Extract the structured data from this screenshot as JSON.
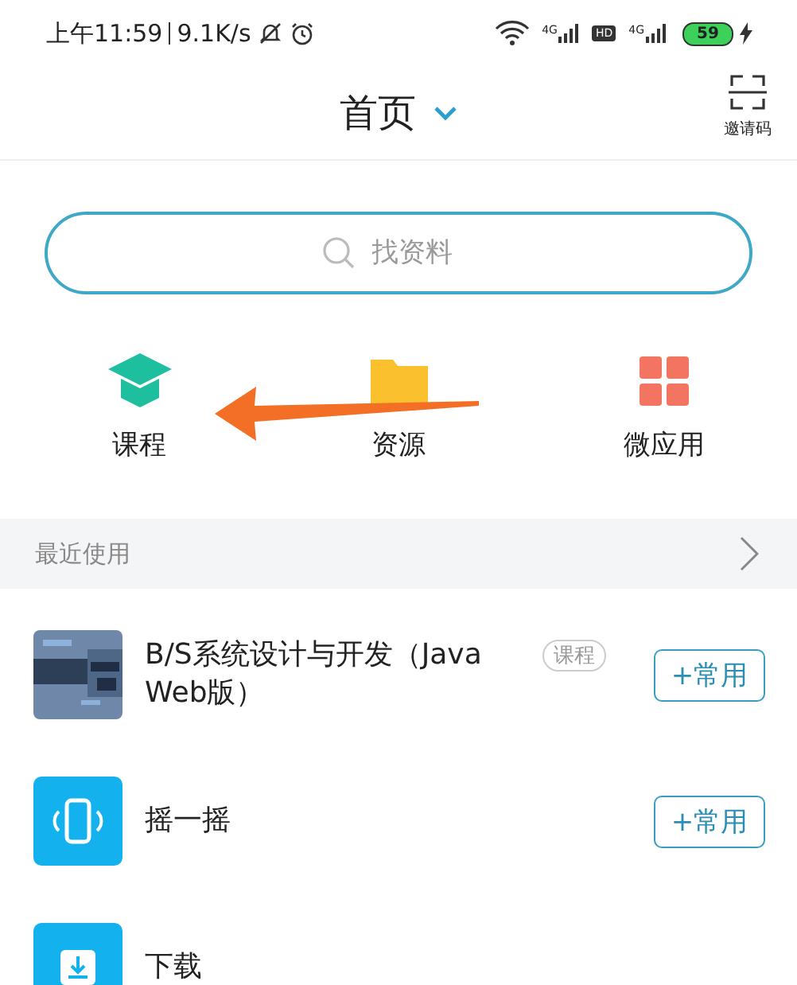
{
  "status_bar": {
    "time": "上午11:59",
    "speed": "9.1K/s",
    "networks": [
      {
        "label": "4G"
      },
      {
        "label": "4G"
      }
    ],
    "hd": "HD",
    "battery": "59"
  },
  "header": {
    "title": "首页",
    "invite_label": "邀请码"
  },
  "search": {
    "placeholder": "找资料"
  },
  "shortcuts": [
    {
      "kind": "course",
      "label": "课程"
    },
    {
      "kind": "resource",
      "label": "资源"
    },
    {
      "kind": "app",
      "label": "微应用"
    }
  ],
  "recent": {
    "title": "最近使用",
    "items": [
      {
        "kind": "picture",
        "title": "B/S系统设计与开发（Java Web版）",
        "tag": "课程",
        "action": "+常用"
      },
      {
        "kind": "shake",
        "title": "摇一摇",
        "action": "+常用"
      },
      {
        "kind": "download",
        "title": "下载"
      }
    ]
  }
}
